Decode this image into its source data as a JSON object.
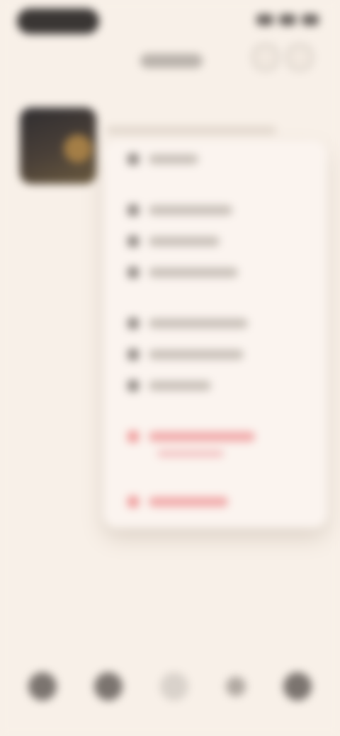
{
  "status_bar": {
    "left_icon": "status-pill",
    "right_icons": [
      "signal-icon",
      "wifi-icon",
      "battery-icon"
    ]
  },
  "header": {
    "title": "",
    "icons": [
      "share-icon",
      "more-icon"
    ]
  },
  "thumbnail": {
    "caption": ""
  },
  "menu": {
    "items": [
      {
        "label": "",
        "icon": "list-icon",
        "danger": false
      },
      {
        "label": "",
        "icon": "edit-icon",
        "danger": false
      },
      {
        "label": "",
        "icon": "copy-icon",
        "danger": false
      },
      {
        "label": "",
        "icon": "move-icon",
        "danger": false
      },
      {
        "label": "",
        "icon": "link-icon",
        "danger": false
      },
      {
        "label": "",
        "icon": "folder-icon",
        "danger": false
      },
      {
        "label": "",
        "icon": "image-icon",
        "danger": false
      },
      {
        "label": "",
        "icon": "warning-icon",
        "danger": true
      },
      {
        "label": "",
        "icon": "trash-icon",
        "danger": true
      }
    ]
  },
  "bottom_nav": {
    "items": [
      {
        "label": "",
        "icon": "home-icon"
      },
      {
        "label": "",
        "icon": "search-icon"
      },
      {
        "label": "",
        "icon": "add-icon"
      },
      {
        "label": "",
        "icon": "activity-icon"
      },
      {
        "label": "",
        "icon": "profile-icon"
      }
    ]
  },
  "colors": {
    "background": "#f8f0e8",
    "menu_background": "#fbf4ef",
    "danger": "#ef9b9b",
    "text_muted": "#c8c0b8"
  }
}
